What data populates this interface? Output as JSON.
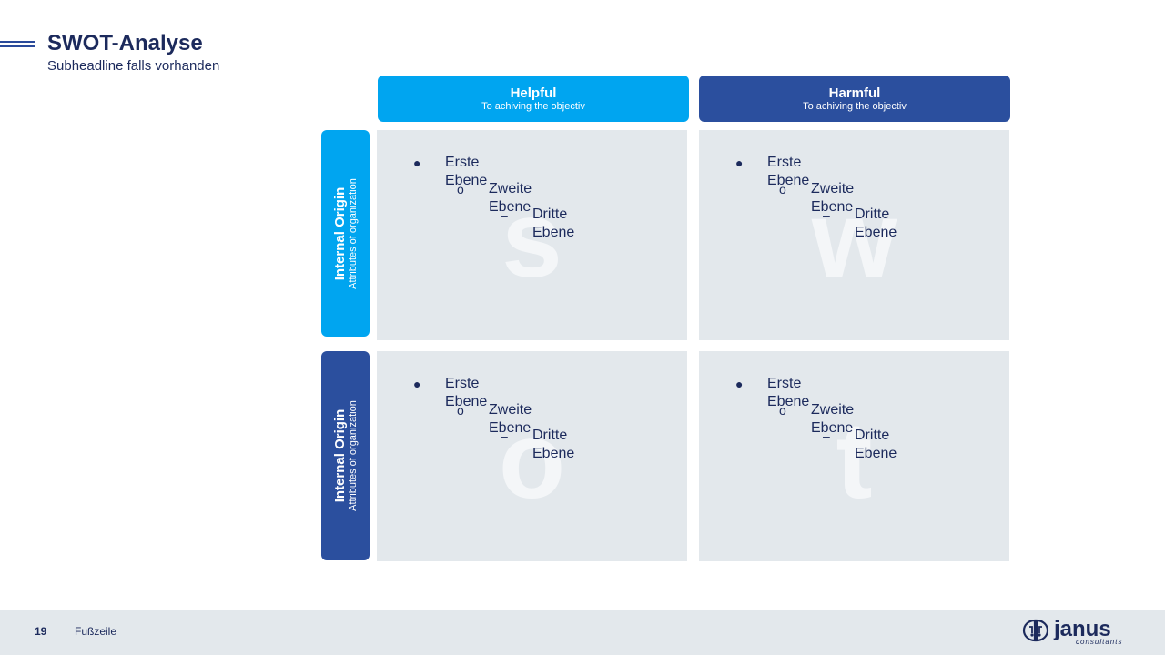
{
  "header": {
    "title": "SWOT-Analyse",
    "subtitle": "Subheadline falls vorhanden"
  },
  "columns": [
    {
      "label": "Helpful",
      "sub": "To achiving the objectiv",
      "color": "#00a5f0"
    },
    {
      "label": "Harmful",
      "sub": "To achiving the objectiv",
      "color": "#2b4f9e"
    }
  ],
  "rows": [
    {
      "label": "Internal Origin",
      "sub": "Attributes of organization",
      "color": "#00a5f0"
    },
    {
      "label": "Internal Origin",
      "sub": "Attributes of organization",
      "color": "#2b4f9e"
    }
  ],
  "quadrants": {
    "s": {
      "letter": "s",
      "items": [
        "Erste Ebene",
        "Zweite Ebene",
        "Dritte Ebene"
      ]
    },
    "w": {
      "letter": "w",
      "items": [
        "Erste Ebene",
        "Zweite Ebene",
        "Dritte Ebene"
      ]
    },
    "o": {
      "letter": "o",
      "items": [
        "Erste Ebene",
        "Zweite Ebene",
        "Dritte Ebene"
      ]
    },
    "t": {
      "letter": "t",
      "items": [
        "Erste Ebene",
        "Zweite Ebene",
        "Dritte Ebene"
      ]
    }
  },
  "bullets": {
    "level1": "●",
    "level2": "o",
    "level3": "–"
  },
  "footer": {
    "page_number": "19",
    "text": "Fußzeile",
    "logo_word": "janus",
    "logo_sub": "consultants"
  },
  "colors": {
    "navy": "#1c2a5c",
    "cyan": "#00a5f0",
    "blue": "#2b4f9e",
    "panel": "#e3e8ec"
  }
}
